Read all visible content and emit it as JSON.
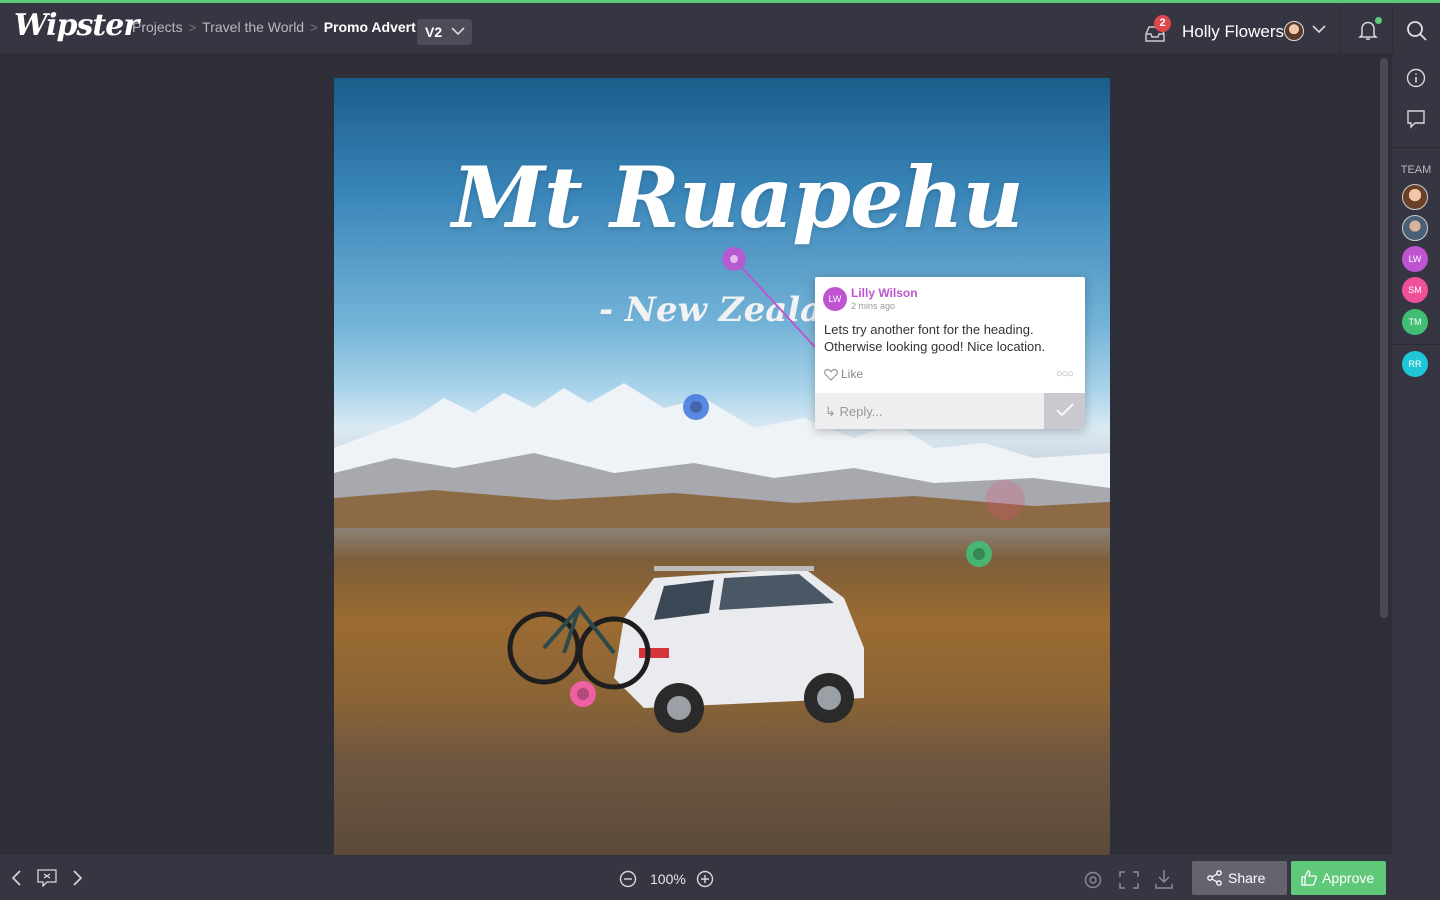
{
  "app": {
    "logo": "Wipster"
  },
  "breadcrumb": {
    "items": [
      "Projects",
      "Travel the World"
    ],
    "current": "Promo Advert",
    "separator": ">"
  },
  "version": {
    "selected": "V2"
  },
  "notifications": {
    "inbox_count": "2"
  },
  "user": {
    "name": "Holly Flowers"
  },
  "asset": {
    "title": "Mt Ruapehu",
    "subtitle": "- New Zealand"
  },
  "comment": {
    "initials": "LW",
    "author": "Lilly Wilson",
    "time": "2 mins ago",
    "text": "Lets try another font for the heading. Otherwise looking good! Nice location.",
    "like_label": "Like",
    "more": "○○○",
    "reply_placeholder": "Reply..."
  },
  "sidebar": {
    "team_label": "TEAM",
    "members": [
      {
        "initials": "",
        "color": "#8a5a3a"
      },
      {
        "initials": "",
        "color": "#4a5f78"
      },
      {
        "initials": "LW",
        "color": "#bf54d2"
      },
      {
        "initials": "SM",
        "color": "#f0509a"
      },
      {
        "initials": "TM",
        "color": "#3fbe74"
      },
      {
        "initials": "RR",
        "color": "#1fc6d6"
      }
    ]
  },
  "toolbar": {
    "zoom": "100%",
    "share_label": "Share",
    "approve_label": "Approve"
  },
  "colors": {
    "accent_green": "#5fc879",
    "comment_purple": "#bf54d2",
    "badge_red": "#e0474c"
  }
}
